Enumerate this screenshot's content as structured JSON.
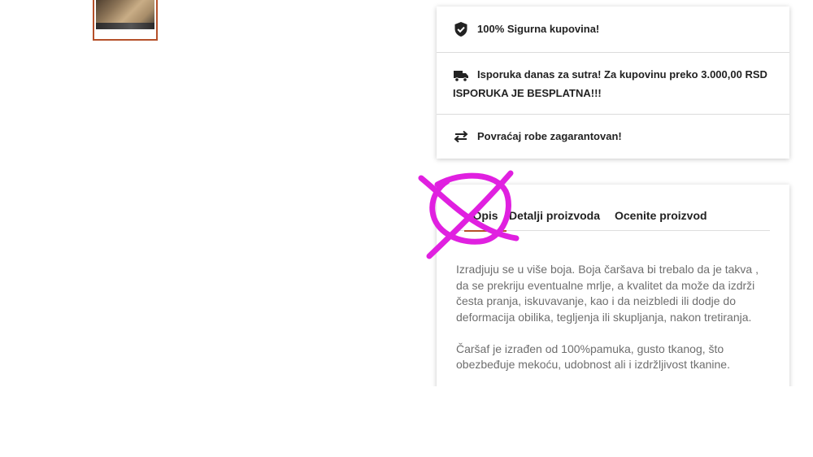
{
  "features": [
    {
      "icon": "shield-check-icon",
      "text": "100% Sigurna kupovina!"
    },
    {
      "icon": "delivery-truck-icon",
      "text": "Isporuka danas za sutra! Za kupovinu preko 3.000,00 RSD",
      "text2": "ISPORUKA JE BESPLATNA!!!"
    },
    {
      "icon": "return-arrows-icon",
      "text": "Povraćaj robe zagarantovan!"
    }
  ],
  "tabs": [
    {
      "label": "Opis",
      "active": true
    },
    {
      "label": "Detalji proizvoda",
      "active": false
    },
    {
      "label": "Ocenite proizvod",
      "active": false
    }
  ],
  "description": {
    "paragraph1": "Izradjuju se u više boja. Boja čaršava bi trebalo da je takva , da se prekriju eventualne mrlje, a kvalitet da može da izdrži česta pranja, iskuvavanje, kao i da neizbledi ili dodje do deformacija obilika, tegljenja ili skupljanja, nakon tretiranja.",
    "paragraph2": "Čaršaf je izrađen od 100%pamuka, gusto tkanog, što obezbeđuje mekoću, udobnost ali i izdržljivost tkanine."
  },
  "colors": {
    "accent": "#b5502a",
    "scribble": "#e020e0"
  }
}
